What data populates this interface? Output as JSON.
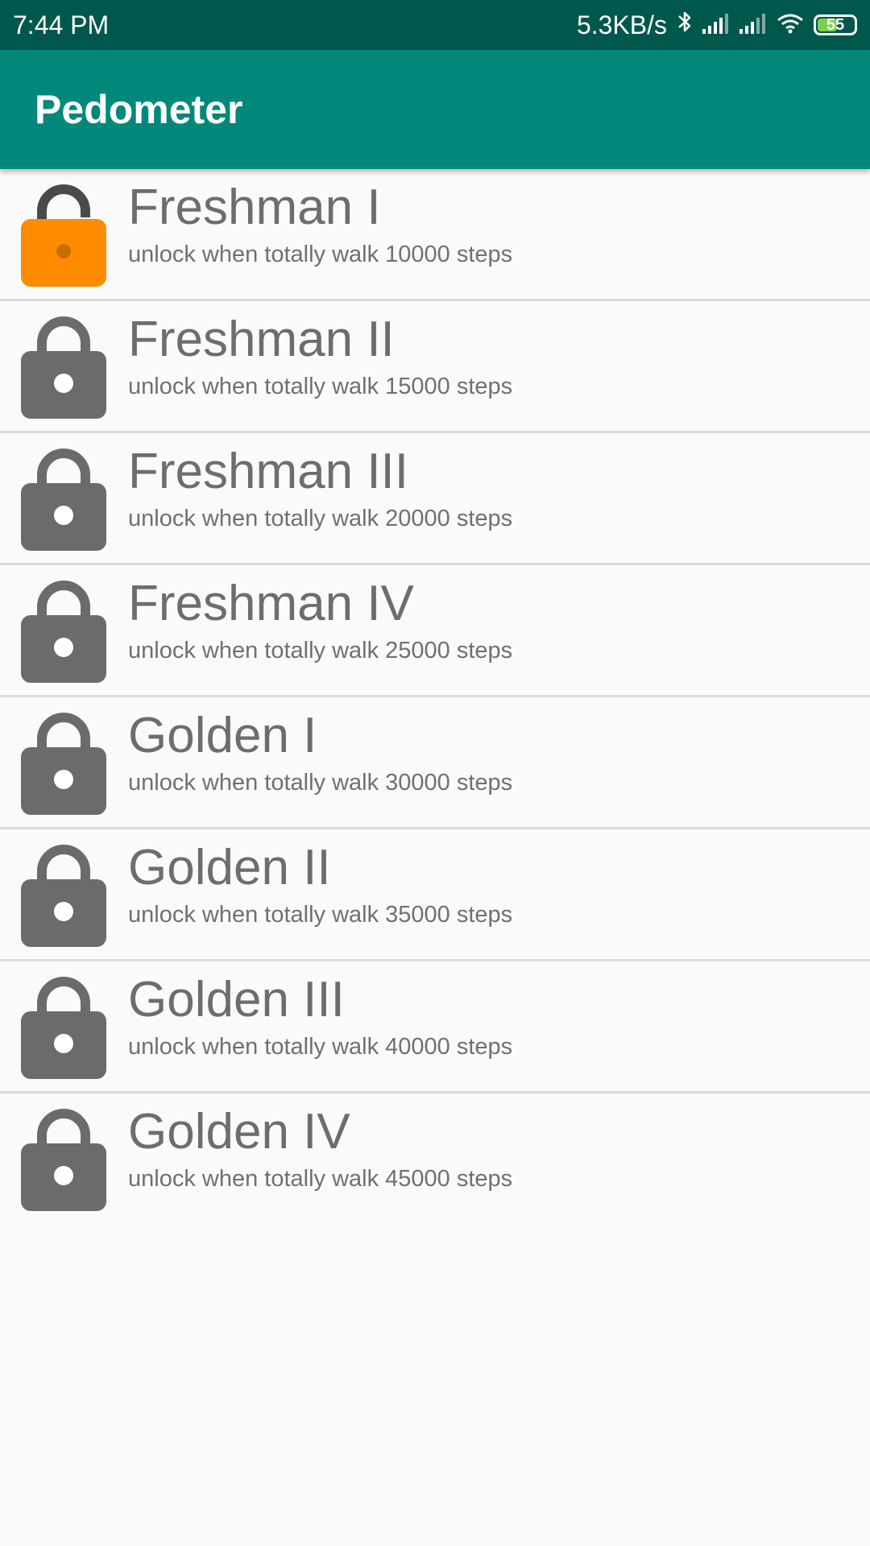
{
  "status_bar": {
    "time": "7:44 PM",
    "speed": "5.3KB/s",
    "battery": "55",
    "battery_level": 0.55,
    "icons": [
      "bluetooth-icon",
      "signal-icon",
      "signal-icon",
      "wifi-icon",
      "battery-icon"
    ]
  },
  "app_bar": {
    "title": "Pedometer"
  },
  "colors": {
    "status_bar": "#00574b",
    "app_bar": "#00897b",
    "unlocked_lock": "#ff8c00",
    "locked_lock": "#6b6b6b",
    "background": "#fafafa"
  },
  "achievements": [
    {
      "title": "Freshman I",
      "subtitle": "unlock when totally walk 10000 steps",
      "unlocked": true,
      "icon": "unlocked-lock-icon"
    },
    {
      "title": "Freshman II",
      "subtitle": "unlock when totally walk 15000 steps",
      "unlocked": false,
      "icon": "lock-icon"
    },
    {
      "title": "Freshman III",
      "subtitle": "unlock when totally walk 20000 steps",
      "unlocked": false,
      "icon": "lock-icon"
    },
    {
      "title": "Freshman IV",
      "subtitle": "unlock when totally walk 25000 steps",
      "unlocked": false,
      "icon": "lock-icon"
    },
    {
      "title": "Golden I",
      "subtitle": "unlock when totally walk 30000 steps",
      "unlocked": false,
      "icon": "lock-icon"
    },
    {
      "title": "Golden II",
      "subtitle": "unlock when totally walk 35000 steps",
      "unlocked": false,
      "icon": "lock-icon"
    },
    {
      "title": "Golden III",
      "subtitle": "unlock when totally walk 40000 steps",
      "unlocked": false,
      "icon": "lock-icon"
    },
    {
      "title": "Golden IV",
      "subtitle": "unlock when totally walk 45000 steps",
      "unlocked": false,
      "icon": "lock-icon"
    }
  ]
}
